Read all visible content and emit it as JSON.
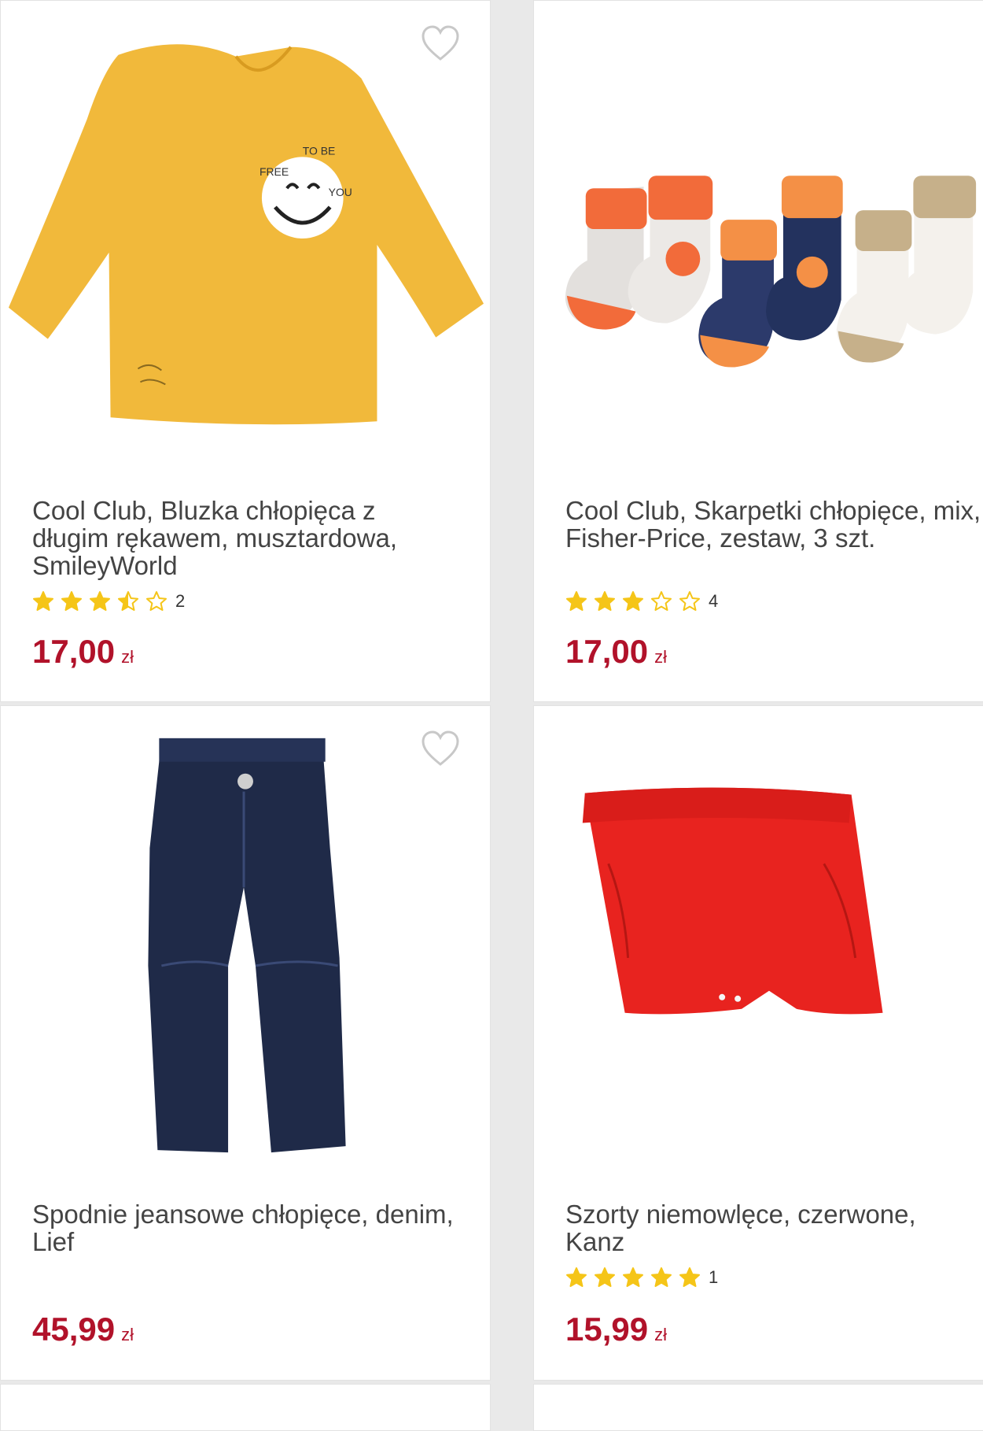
{
  "products": [
    {
      "title": "Cool Club, Bluzka chłopięca z długim rękawem, musztardowa, SmileyWorld",
      "rating": 3.5,
      "reviews": "2",
      "price": "17,00",
      "currency": "zł",
      "image": "mustard-long-sleeve-shirt",
      "print_text": [
        "FREE",
        "TO BE",
        "YOU"
      ]
    },
    {
      "title": "Cool Club, Skarpetki chłopięce, mix, Fisher-Price, zestaw, 3 szt.",
      "rating": 3,
      "reviews": "4",
      "price": "17,00",
      "currency": "zł",
      "image": "baby-socks-set"
    },
    {
      "title": "Spodnie jeansowe chłopięce, denim, Lief",
      "rating": null,
      "reviews": "",
      "price": "45,99",
      "currency": "zł",
      "image": "navy-denim-jeans"
    },
    {
      "title": "Szorty niemowlęce, czerwone, Kanz",
      "rating": 5,
      "reviews": "1",
      "price": "15,99",
      "currency": "zł",
      "image": "red-baby-shorts"
    }
  ],
  "colors": {
    "price": "#b1122a",
    "star": "#f5c518",
    "heart_outline": "#c8c8c8"
  },
  "icons": {
    "favorite": "heart-outline-icon",
    "rating": "star-icon"
  }
}
